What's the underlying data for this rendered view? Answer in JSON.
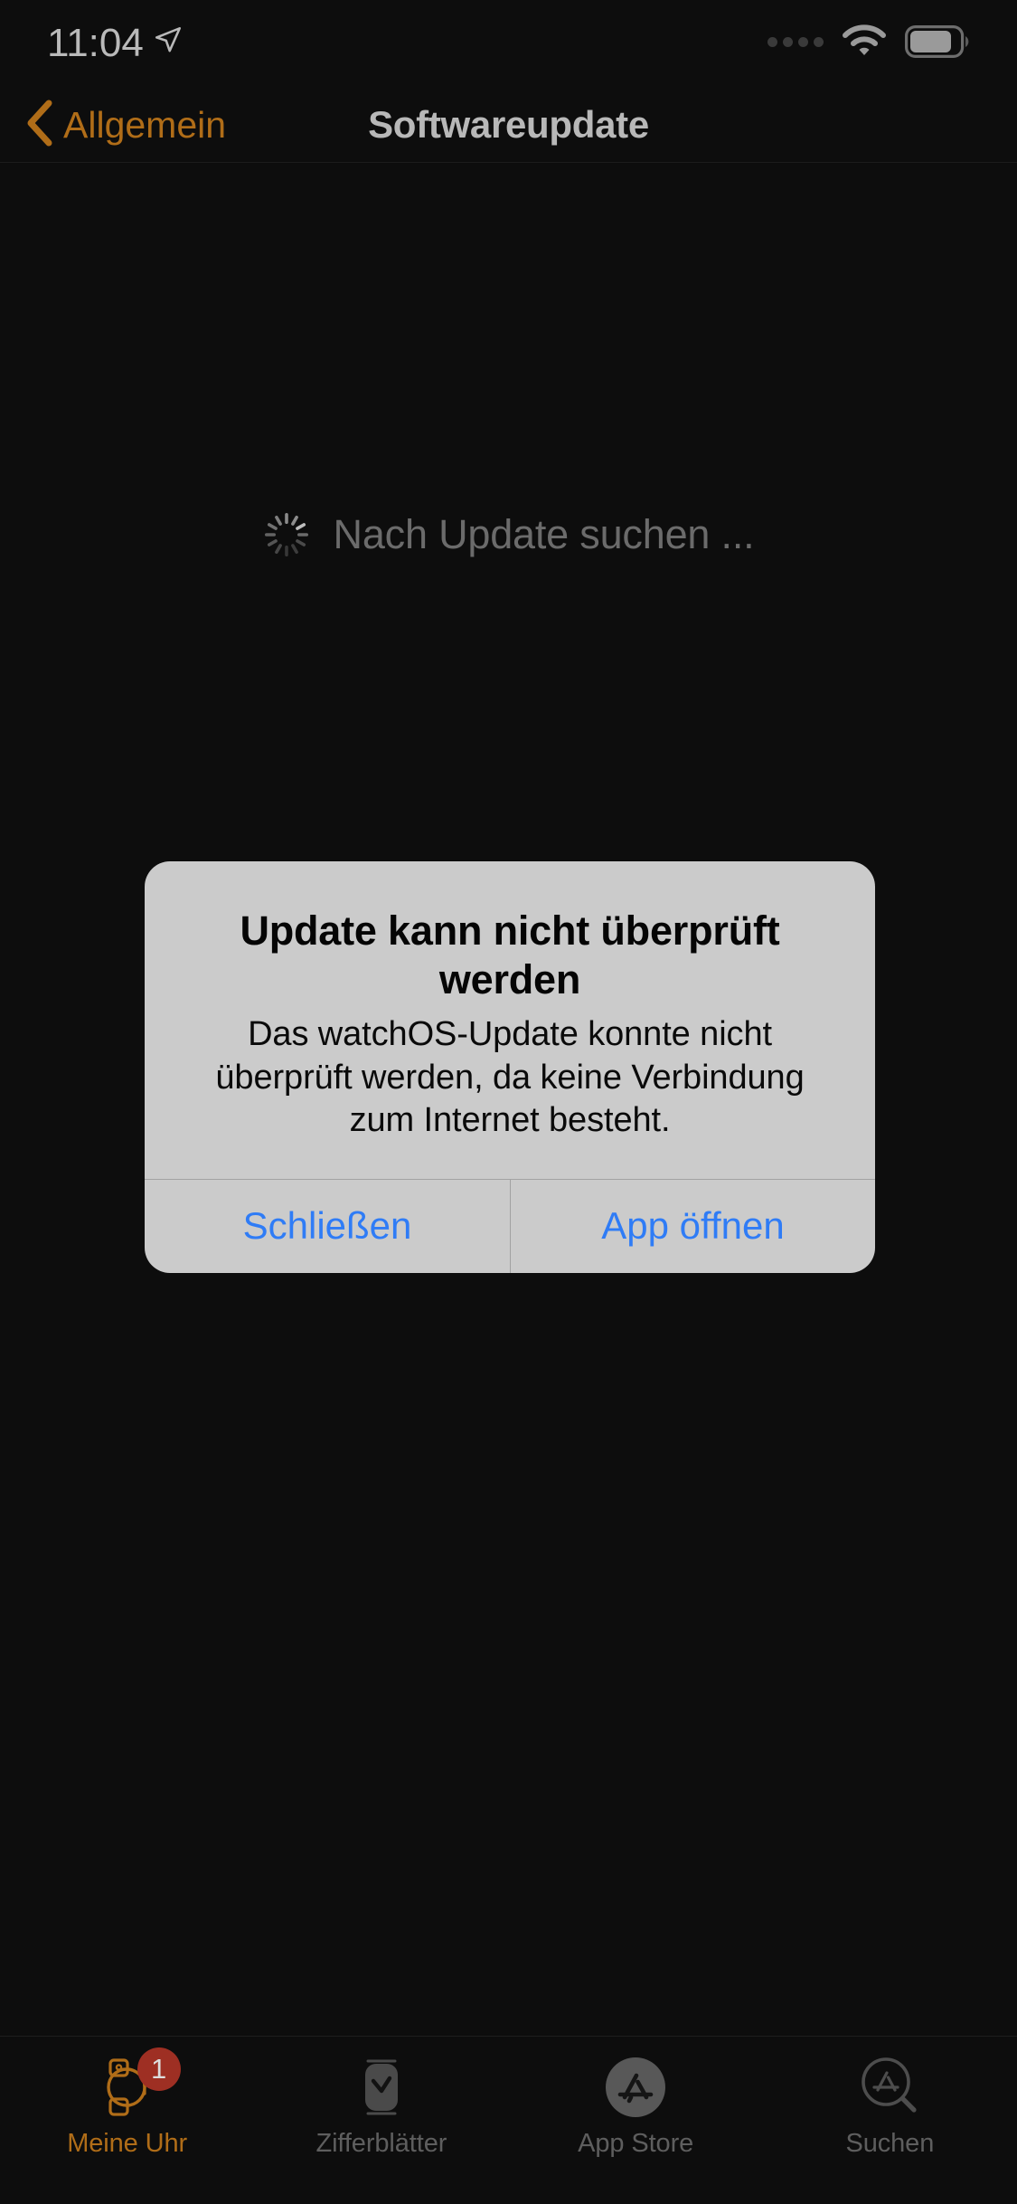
{
  "status_bar": {
    "time": "11:04",
    "location_icon": "location-arrow-icon",
    "signal_icon": "cellular-dots-icon",
    "wifi_icon": "wifi-icon",
    "battery_icon": "battery-icon",
    "battery_level": 80
  },
  "nav_bar": {
    "back_label": "Allgemein",
    "back_icon": "chevron-left-icon",
    "title": "Softwareupdate",
    "tint_color": "#b06d18"
  },
  "content": {
    "checking_label": "Nach Update suchen ...",
    "spinner_icon": "activity-spinner-icon"
  },
  "alert": {
    "title": "Update kann nicht überprüft werden",
    "message": "Das watchOS-Update konnte nicht überprüft werden, da keine Verbindung zum Internet besteht.",
    "buttons": [
      {
        "label": "Schließen",
        "name": "dismiss-button"
      },
      {
        "label": "App öffnen",
        "name": "open-app-button"
      }
    ],
    "background_color": "#cbcbcb",
    "button_color": "#2f7cf6"
  },
  "tab_bar": {
    "items": [
      {
        "label": "Meine Uhr",
        "icon": "watch-icon",
        "active": true,
        "badge": "1"
      },
      {
        "label": "Zifferblätter",
        "icon": "watch-face-icon",
        "active": false,
        "badge": ""
      },
      {
        "label": "App Store",
        "icon": "app-store-icon",
        "active": false,
        "badge": ""
      },
      {
        "label": "Suchen",
        "icon": "app-store-search-icon",
        "active": false,
        "badge": ""
      }
    ],
    "active_color": "#b06d18",
    "inactive_color": "#5e5e5e",
    "badge_color": "#9e2f23"
  }
}
